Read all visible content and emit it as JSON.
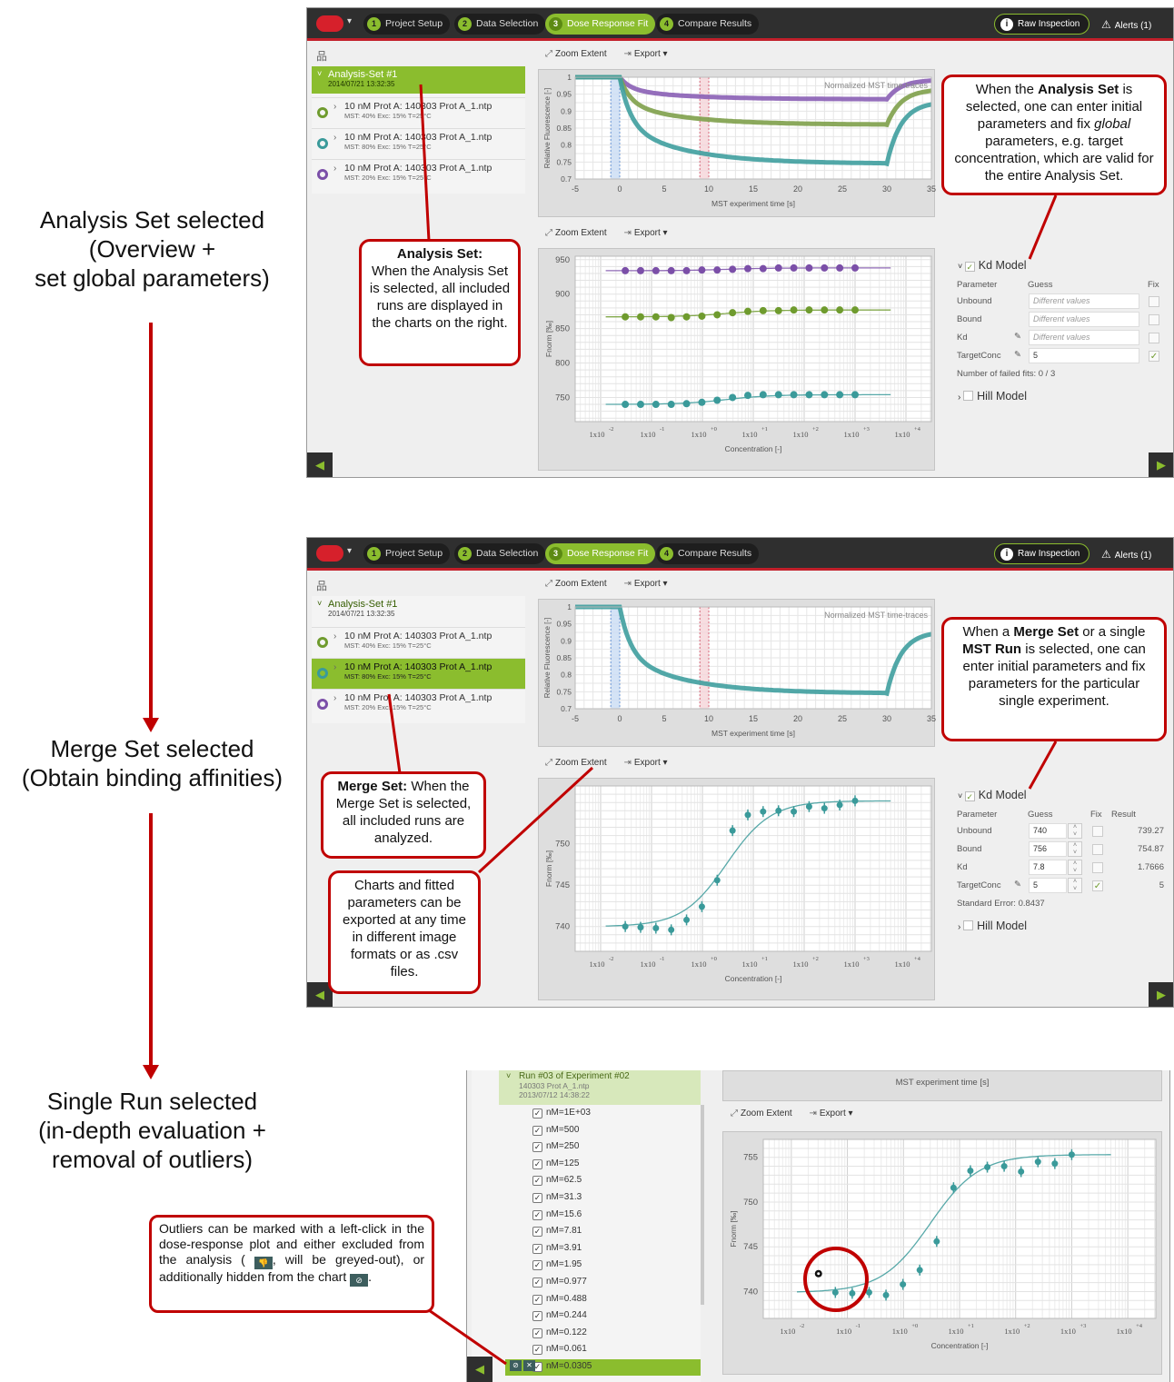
{
  "labels": {
    "analysis": [
      "Analysis Set selected",
      "(Overview +",
      "set global parameters)"
    ],
    "merge": [
      "Merge Set selected",
      "(Obtain binding affinities)"
    ],
    "single": [
      "Single Run selected",
      "(in-depth evaluation +",
      "removal of outliers)"
    ]
  },
  "steps": [
    {
      "num": "1",
      "label": "Project Setup"
    },
    {
      "num": "2",
      "label": "Data Selection"
    },
    {
      "num": "3",
      "label": "Dose Response Fit"
    },
    {
      "num": "4",
      "label": "Compare Results"
    }
  ],
  "raw_inspection": "Raw Inspection",
  "alerts": "Alerts (1)",
  "toolbar": {
    "zoom": "Zoom Extent",
    "export": "Export"
  },
  "tree": {
    "analysis_title": "Analysis-Set #1",
    "analysis_date": "2014/07/21 13:32:35",
    "runs_p1": [
      {
        "name": "10 nM Prot A: 140303 Prot A_1.ntp",
        "meta": "MST: 40%  Exc: 15%  T=25°C",
        "color": "#6f9b2e"
      },
      {
        "name": "10 nM Prot A: 140303 Prot A_1.ntp",
        "meta": "MST: 80%  Exc: 15%  T=25°C",
        "color": "#3a9a9a"
      },
      {
        "name": "10 nM Prot A: 140303 Prot A_1.ntp",
        "meta": "MST: 20%  Exc: 15%  T=25°C",
        "color": "#7b4fa8"
      }
    ],
    "runs_p2": [
      {
        "name": "10 nM Prot A: 140303 Prot A_1.ntp",
        "meta": "MST: 40%  Exc: 15%  T=25°C",
        "color": "#6f9b2e"
      },
      {
        "name": "10 nM Prot A: 140303 Prot A_1.ntp",
        "meta": "MST: 80%  Exc: 15%  T=25°C",
        "color": "#3a9a9a"
      },
      {
        "name": "10 nM Prot A: 140303 Prot A_1.ntp",
        "meta": "MST: 20%  Exc: 15%  T=25°C",
        "color": "#7b4fa8"
      }
    ]
  },
  "trace_chart": {
    "annotation": "Normalized MST time-traces",
    "ylabel": "Relative Fluorescence [-]",
    "xlabel": "MST experiment time [s]",
    "xticks": [
      "-5",
      "0",
      "5",
      "10",
      "15",
      "20",
      "25",
      "30",
      "35"
    ],
    "yticks": [
      "1",
      "0.95",
      "0.9",
      "0.85",
      "0.8",
      "0.75",
      "0.7"
    ]
  },
  "dose_chart": {
    "ylabel": "Fnorm [‰]",
    "xlabel": "Concentration [-]",
    "xticks": [
      "1x10",
      "1x10",
      "1x10",
      "1x10",
      "1x10",
      "1x10",
      "1x10"
    ],
    "xexp": [
      "-2",
      "-1",
      "+0",
      "+1",
      "+2",
      "+3",
      "+4"
    ],
    "p1_yticks": [
      "950",
      "900",
      "850",
      "800",
      "750"
    ],
    "p2_yticks": [
      "750",
      "745",
      "740"
    ],
    "p3_yticks": [
      "755",
      "750",
      "745",
      "740"
    ]
  },
  "chart_data": [
    {
      "type": "line",
      "title": "Normalized MST time-traces",
      "xlabel": "MST experiment time [s]",
      "ylabel": "Relative Fluorescence [-]",
      "xlim": [
        -5,
        35
      ],
      "ylim": [
        0.7,
        1.0
      ],
      "x": [
        -5,
        0,
        1,
        5,
        10,
        20,
        29.9,
        30.5,
        35
      ],
      "series": [
        {
          "values": [
            1.0,
            1.0,
            0.97,
            0.95,
            0.94,
            0.935,
            0.935,
            0.97,
            0.99
          ],
          "color": "#8a5fb5"
        },
        {
          "values": [
            1.0,
            1.0,
            0.94,
            0.9,
            0.875,
            0.865,
            0.86,
            0.92,
            0.96
          ],
          "color": "#7ea04a"
        },
        {
          "values": [
            1.0,
            1.0,
            0.89,
            0.81,
            0.77,
            0.75,
            0.745,
            0.84,
            0.92
          ],
          "color": "#3f9f9f"
        }
      ]
    },
    {
      "type": "scatter",
      "xlabel": "Concentration [-]",
      "ylabel": "Fnorm [‰]",
      "xscale": "log",
      "ylim": [
        715,
        955
      ],
      "x": [
        0.0305,
        0.061,
        0.122,
        0.244,
        0.488,
        0.977,
        1.95,
        3.91,
        7.81,
        15.6,
        31.3,
        62.5,
        125,
        250,
        500,
        1000
      ],
      "series": [
        {
          "values": [
            934,
            934,
            934,
            934,
            934,
            935,
            935,
            936,
            937,
            937,
            938,
            938,
            938,
            938,
            938,
            938
          ],
          "color": "#7b4fa8"
        },
        {
          "values": [
            867,
            867,
            867,
            866,
            867,
            868,
            870,
            873,
            875,
            876,
            876,
            877,
            877,
            877,
            877,
            877
          ],
          "color": "#6f9b2e"
        },
        {
          "values": [
            740,
            740,
            740,
            740,
            741,
            743,
            746,
            750,
            753,
            754,
            754,
            754,
            754,
            754,
            754,
            754
          ],
          "color": "#3a9a9a"
        }
      ]
    },
    {
      "type": "scatter",
      "xlabel": "Concentration [-]",
      "ylabel": "Fnorm [‰]",
      "xscale": "log",
      "ylim": [
        737,
        757
      ],
      "x": [
        0.0305,
        0.061,
        0.122,
        0.244,
        0.488,
        0.977,
        1.95,
        3.91,
        7.81,
        15.6,
        31.3,
        62.5,
        125,
        250,
        500,
        1000
      ],
      "series": [
        {
          "name": "data",
          "values": [
            740.0,
            739.9,
            739.8,
            739.6,
            740.8,
            742.4,
            745.6,
            751.6,
            753.5,
            753.9,
            754.0,
            753.9,
            754.5,
            754.3,
            754.7,
            755.2
          ],
          "color": "#3a9a9a"
        }
      ]
    },
    {
      "type": "scatter",
      "xlabel": "Concentration [-]",
      "ylabel": "Fnorm [‰]",
      "xscale": "log",
      "ylim": [
        737,
        757
      ],
      "x": [
        0.061,
        0.122,
        0.244,
        0.488,
        0.977,
        1.95,
        3.91,
        7.81,
        15.6,
        31.3,
        62.5,
        125,
        250,
        500,
        1000
      ],
      "series": [
        {
          "name": "data",
          "values": [
            739.9,
            739.8,
            739.9,
            739.6,
            740.8,
            742.4,
            745.6,
            751.6,
            753.5,
            753.9,
            754.0,
            753.4,
            754.5,
            754.3,
            755.3
          ],
          "color": "#3a9a9a"
        },
        {
          "name": "outlier",
          "values": [
            742.0
          ],
          "color": "#000000"
        }
      ]
    }
  ],
  "params_p1": {
    "model": "Kd Model",
    "headers": [
      "Parameter",
      "Guess",
      "Fix"
    ],
    "rows": [
      {
        "name": "Unbound",
        "guess": "Different values",
        "fix": false
      },
      {
        "name": "Bound",
        "guess": "Different values",
        "fix": false
      },
      {
        "name": "Kd",
        "guess": "Different values",
        "fix": false
      },
      {
        "name": "TargetConc",
        "guess": "5",
        "fix": true
      }
    ],
    "footer": "Number of failed fits: 0 / 3",
    "hill": "Hill Model"
  },
  "params_p2": {
    "model": "Kd Model",
    "headers": [
      "Parameter",
      "Guess",
      "Fix",
      "Result"
    ],
    "rows": [
      {
        "name": "Unbound",
        "guess": "740",
        "result": "739.27",
        "fix": false
      },
      {
        "name": "Bound",
        "guess": "756",
        "result": "754.87",
        "fix": false
      },
      {
        "name": "Kd",
        "guess": "7.8",
        "result": "1.7666",
        "fix": false
      },
      {
        "name": "TargetConc",
        "guess": "5",
        "result": "5",
        "fix": true
      }
    ],
    "footer": "Standard Error: 0.8437",
    "hill": "Hill Model"
  },
  "panel3": {
    "run_title": "Run #03 of Experiment #02",
    "run_file": "140303 Prot A_1.ntp",
    "run_date": "2013/07/12 14:38:22",
    "top_label": "MST experiment time [s]",
    "concentrations": [
      "nM=1E+03",
      "nM=500",
      "nM=250",
      "nM=125",
      "nM=62.5",
      "nM=31.3",
      "nM=15.6",
      "nM=7.81",
      "nM=3.91",
      "nM=1.95",
      "nM=0.977",
      "nM=0.488",
      "nM=0.244",
      "nM=0.122",
      "nM=0.061",
      "nM=0.0305"
    ]
  },
  "callouts": {
    "analysis_set_title": "Analysis Set:",
    "analysis_set_body": "When the Analysis Set is selected, all included runs are displayed in the charts on the right.",
    "global_1": "When the ",
    "global_b1": "Analysis Set",
    "global_2": " is selected, one can enter initial parameters and fix ",
    "global_i": "global",
    "global_3": " parameters, e.g. target concentration, which are valid for the entire Analysis Set.",
    "merge_title": "Merge Set:",
    "merge_body": " When the Merge Set is selected, all included runs are analyzed.",
    "merge_right_1": "When a ",
    "merge_right_b1": "Merge Set",
    "merge_right_2": " or a single ",
    "merge_right_b2": "MST Run",
    "merge_right_3": " is selected, one can enter initial parameters and fix parameters for the particular single experiment.",
    "export_note": "Charts and fitted parameters can be exported at any time in different image formats or as .csv files.",
    "outliers_1": "Outliers can be marked with a left-click in the dose-response plot and either excluded from the analysis (",
    "outliers_2": ", will be greyed-out), or additionally hidden from the chart",
    "outliers_3": "."
  },
  "colors": {
    "accent": "#8bbd2e",
    "red": "#c00000",
    "teal": "#3a9a9a",
    "purple": "#7b4fa8",
    "green": "#6f9b2e"
  }
}
